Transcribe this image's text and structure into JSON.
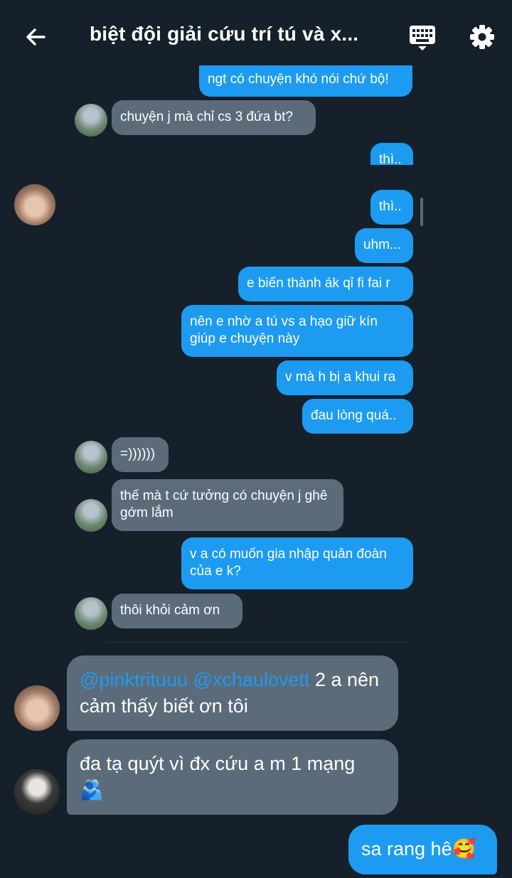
{
  "header": {
    "title": "biệt đội giải cứu trí tú và x..."
  },
  "icons": {
    "back": "arrow-left-icon",
    "keyboard": "keyboard-icon",
    "settings": "gear-icon"
  },
  "colors": {
    "background": "#15202b",
    "accent": "#1d9bf0",
    "incoming_bubble": "#5c6b7a"
  },
  "screenshot_messages": [
    {
      "sender": "me",
      "text": "ngt có chuyện khó nói chứ bộ!"
    },
    {
      "sender": "them",
      "text": "chuyện j mà chỉ cs 3 đứa bt?"
    },
    {
      "sender": "me",
      "text": "thì.."
    },
    {
      "sender": "me",
      "text": "thì.."
    },
    {
      "sender": "me",
      "text": "uhm..."
    },
    {
      "sender": "me",
      "text": "e biến thành ák qỉ fi fai r"
    },
    {
      "sender": "me",
      "text": "nên e nhờ a tú vs a hạo giữ kín giúp e chuyện này"
    },
    {
      "sender": "me",
      "text": "v mà h bị a khui ra"
    },
    {
      "sender": "me",
      "text": "đau lòng quá.."
    },
    {
      "sender": "them",
      "text": "=))))))"
    },
    {
      "sender": "them",
      "text": "thế mà t cứ tưởng có chuyện j ghê gớm lắm"
    },
    {
      "sender": "me",
      "text": "v a có muốn gia nhập quân đoàn của e k?"
    },
    {
      "sender": "them",
      "text": "thôi khỏi cảm ơn"
    }
  ],
  "replies": [
    {
      "mention": "@pinktrituuu @xchaulovett",
      "text": " 2 a nên cảm thấy biết ơn tôi"
    },
    {
      "text": "đa tạ quýt vì đx cứu a m 1 mạng",
      "emoji": "🫂"
    },
    {
      "text": "sa rang hê",
      "emoji": "🥰"
    }
  ]
}
